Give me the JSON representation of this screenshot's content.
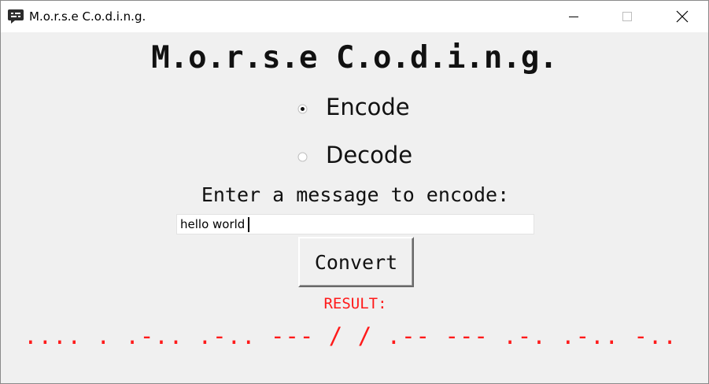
{
  "window": {
    "title": "M.o.r.s.e C.o.d.i.n.g.",
    "icons": {
      "app": "chat-bubble-icon",
      "minimize": "minimize-icon",
      "maximize": "maximize-icon",
      "close": "close-icon"
    }
  },
  "main": {
    "heading": "M.o.r.s.e C.o.d.i.n.g.",
    "mode_options": [
      {
        "label": "Encode",
        "selected": true
      },
      {
        "label": "Decode",
        "selected": false
      }
    ],
    "prompt": "Enter a message to encode:",
    "input_value": "hello world",
    "convert_label": "Convert",
    "result_label": "RESULT:",
    "result_value": ".... . .-.. .-.. --- / / .-- --- .-. .-.. -.."
  },
  "colors": {
    "result": "#ff1a1a",
    "background": "#f0f0f0"
  }
}
